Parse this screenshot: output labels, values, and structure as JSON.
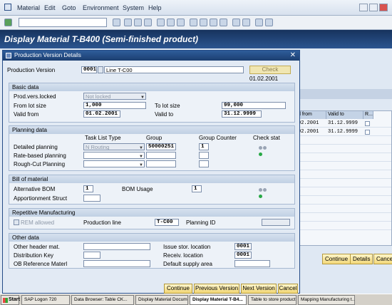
{
  "menu": {
    "items": [
      "Material",
      "Edit",
      "Goto",
      "Environment",
      "System",
      "Help"
    ]
  },
  "header": {
    "title": "Display Material T-B400 (Semi-finished product)"
  },
  "dialog": {
    "title": "Production Version Details",
    "prod_version_label": "Production Version",
    "prod_version_value": "0001",
    "prod_version_text": "Line T-C00",
    "check_label": "Check",
    "check_date": "01.02.2001",
    "basic": {
      "title": "Basic data",
      "locked_label": "Prod.vers.locked",
      "locked_value": "Not locked",
      "from_lot_label": "From lot size",
      "from_lot_value": "1,000",
      "to_lot_label": "To lot size",
      "to_lot_value": "99,000",
      "valid_from_label": "Valid from",
      "valid_from_value": "01.02.2001",
      "valid_to_label": "Valid to",
      "valid_to_value": "31.12.9999"
    },
    "planning": {
      "title": "Planning data",
      "col_task": "Task List Type",
      "col_group": "Group",
      "col_counter": "Group Counter",
      "col_check": "Check stat",
      "detailed_label": "Detailed planning",
      "detailed_type": "N Routing",
      "detailed_group": "50000251",
      "detailed_counter": "1",
      "rate_label": "Rate-based planning",
      "rough_label": "Rough-Cut Planning"
    },
    "bom": {
      "title": "Bill of material",
      "alt_label": "Alternative BOM",
      "alt_value": "1",
      "usage_label": "BOM Usage",
      "usage_value": "1",
      "apportion_label": "Apportionment Struct"
    },
    "rep": {
      "title": "Repetitive Manufacturing",
      "rem_label": "REM allowed",
      "line_label": "Production line",
      "line_value": "T-C00",
      "planning_id_label": "Planning ID"
    },
    "other": {
      "title": "Other data",
      "header_mat_label": "Other header mat.",
      "issue_label": "Issue stor. location",
      "issue_value": "0001",
      "dist_label": "Distribution Key",
      "receiv_label": "Receiv. location",
      "receiv_value": "0001",
      "ob_label": "OB Reference Materl",
      "supply_label": "Default supply area"
    },
    "buttons": {
      "continue": "Continue",
      "previous": "Previous Version",
      "next": "Next Version",
      "cancel": "Cancel"
    }
  },
  "background": {
    "table_headers": [
      "d from",
      "Valid to",
      "R..."
    ],
    "rows": [
      {
        "from": "02.2001",
        "to": "31.12.9999"
      },
      {
        "from": "02.2001",
        "to": "31.12.9999"
      }
    ],
    "buttons": {
      "continue": "Continue",
      "details": "Details",
      "cancel": "Cancel"
    }
  },
  "taskbar": {
    "start": "Start",
    "tasks": [
      "SAP Logon 720",
      "Data Browser: Table CK...",
      "Display Material Docume...",
      "Display Material T-B4...",
      "Table to store product c...",
      "Mapping Manufacturing t..."
    ]
  }
}
